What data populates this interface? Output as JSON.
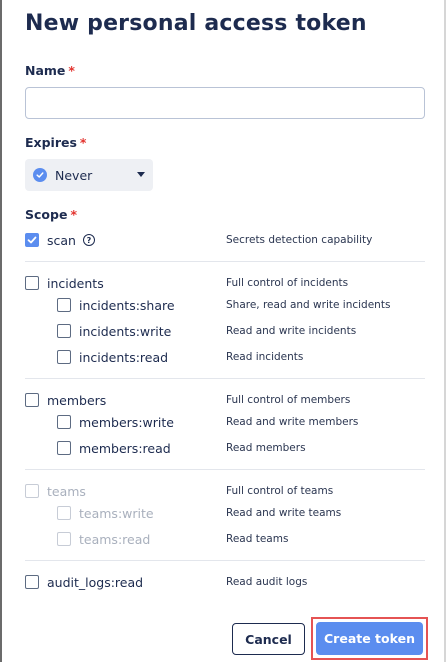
{
  "dialog": {
    "title": "New personal access token"
  },
  "name": {
    "label": "Name",
    "required_mark": "*",
    "value": "",
    "placeholder": ""
  },
  "expires": {
    "label": "Expires",
    "required_mark": "*",
    "selected": "Never"
  },
  "scope": {
    "label": "Scope",
    "required_mark": "*",
    "items": [
      {
        "label": "scan",
        "description": "Secrets detection capability",
        "checked": true,
        "disabled": false
      },
      {
        "label": "incidents",
        "description": "Full control of incidents",
        "checked": false,
        "disabled": false
      },
      {
        "label": "incidents:share",
        "description": "Share, read and write incidents",
        "checked": false,
        "disabled": false
      },
      {
        "label": "incidents:write",
        "description": "Read and write incidents",
        "checked": false,
        "disabled": false
      },
      {
        "label": "incidents:read",
        "description": "Read incidents",
        "checked": false,
        "disabled": false
      },
      {
        "label": "members",
        "description": "Full control of members",
        "checked": false,
        "disabled": false
      },
      {
        "label": "members:write",
        "description": "Read and write members",
        "checked": false,
        "disabled": false
      },
      {
        "label": "members:read",
        "description": "Read members",
        "checked": false,
        "disabled": false
      },
      {
        "label": "teams",
        "description": "Full control of teams",
        "checked": false,
        "disabled": true
      },
      {
        "label": "teams:write",
        "description": "Read and write teams",
        "checked": false,
        "disabled": true
      },
      {
        "label": "teams:read",
        "description": "Read teams",
        "checked": false,
        "disabled": true
      },
      {
        "label": "audit_logs:read",
        "description": "Read audit logs",
        "checked": false,
        "disabled": false
      }
    ]
  },
  "footer": {
    "cancel_label": "Cancel",
    "create_label": "Create token"
  },
  "colors": {
    "accent": "#5b8def",
    "title": "#1d2b4f",
    "required": "#e3342f",
    "highlight": "#e55353"
  }
}
